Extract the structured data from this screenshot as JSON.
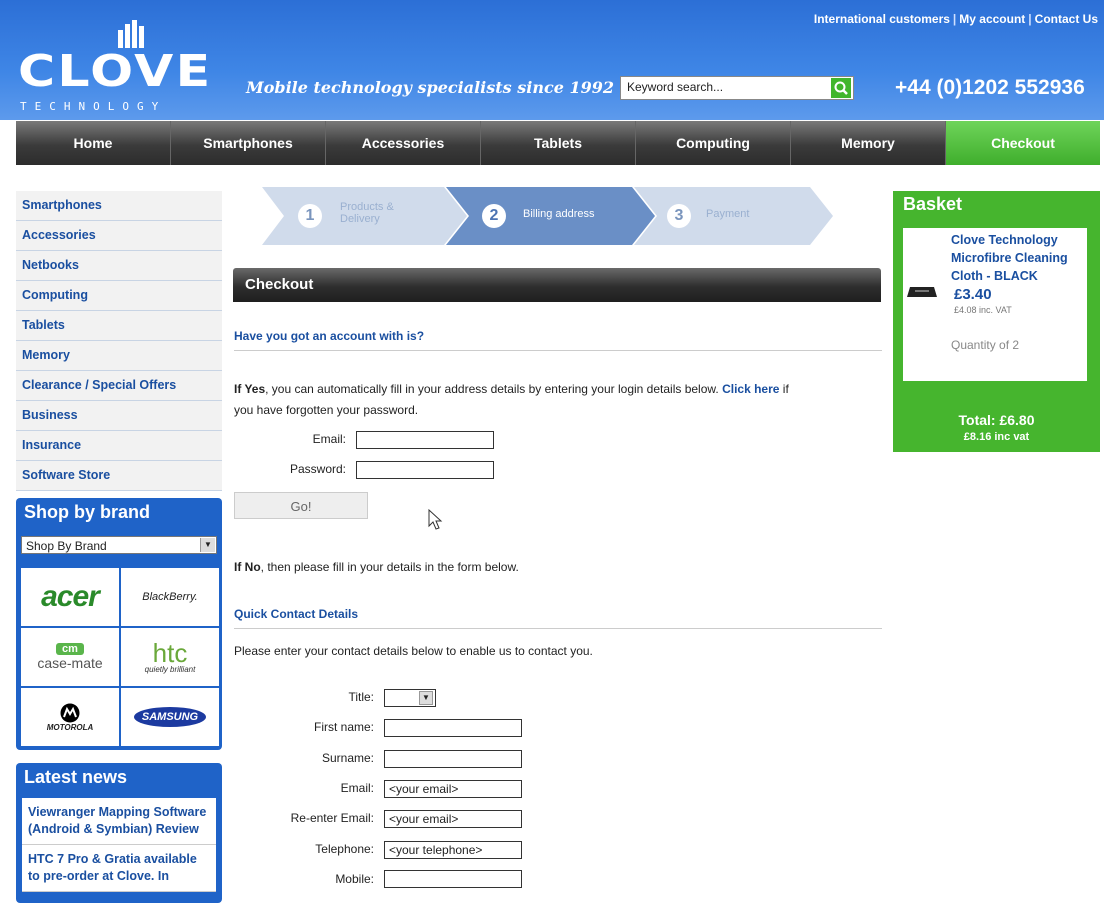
{
  "header": {
    "top_links": [
      "International customers",
      "My account",
      "Contact Us"
    ],
    "logo_word": "CLOVE",
    "logo_sub": "TECHNOLOGY",
    "tagline": "Mobile technology specialists since 1992",
    "search_placeholder": "Keyword search...",
    "phone": "+44 (0)1202 552936",
    "colors": {
      "header": "#3f86e6",
      "nav_dark": "#3b3b3b",
      "checkout_green": "#46b52e",
      "link_blue": "#1a4fa0"
    }
  },
  "nav": {
    "items": [
      "Home",
      "Smartphones",
      "Accessories",
      "Tablets",
      "Computing",
      "Memory",
      "Checkout"
    ]
  },
  "sidebar": {
    "items": [
      "Smartphones",
      "Accessories",
      "Netbooks",
      "Computing",
      "Tablets",
      "Memory",
      "Clearance / Special Offers",
      "Business",
      "Insurance",
      "Software Store"
    ],
    "brand_title": "Shop by brand",
    "brand_select": "Shop By Brand",
    "brands": [
      "acer",
      "BlackBerry.",
      "case-mate",
      "htc",
      "MOTOROLA",
      "SAMSUNG"
    ],
    "brand_extra": {
      "cm": "cm",
      "htc_tag": "quietly brilliant"
    },
    "news_title": "Latest news",
    "news": [
      "Viewranger Mapping Software (Android & Symbian) Review",
      "HTC 7 Pro & Gratia available to pre-order at Clove. In"
    ]
  },
  "steps": [
    {
      "num": "1",
      "label": "Products & Delivery"
    },
    {
      "num": "2",
      "label": "Billing address"
    },
    {
      "num": "3",
      "label": "Payment"
    }
  ],
  "main": {
    "checkout_title": "Checkout",
    "account_heading": "Have you got an account with is?",
    "if_yes_bold": "If Yes",
    "if_yes_text": ", you can automatically fill in your address details by entering your login details below.",
    "click_here": "Click here",
    "if_yes_tail": " if",
    "if_yes_line2": "you have forgotten your password.",
    "login_email_label": "Email:",
    "login_password_label": "Password:",
    "go_label": "Go!",
    "if_no_bold": "If No",
    "if_no_text": ", then please fill in your details in the form below.",
    "quick_heading": "Quick Contact Details",
    "quick_text": "Please enter your contact details below to enable us to contact you.",
    "form": {
      "title_label": "Title:",
      "firstname_label": "First name:",
      "surname_label": "Surname:",
      "email_label": "Email:",
      "email_value": "<your email>",
      "reemail_label": "Re-enter Email:",
      "reemail_value": "<your email>",
      "telephone_label": "Telephone:",
      "telephone_value": "<your telephone>",
      "mobile_label": "Mobile:"
    }
  },
  "basket": {
    "title": "Basket",
    "product_name": "Clove Technology Microfibre Cleaning Cloth - BLACK",
    "price": "£3.40",
    "price_vat": "£4.08 inc. VAT",
    "quantity": "Quantity of 2",
    "total": "Total: £6.80",
    "total_vat": "£8.16 inc vat"
  }
}
